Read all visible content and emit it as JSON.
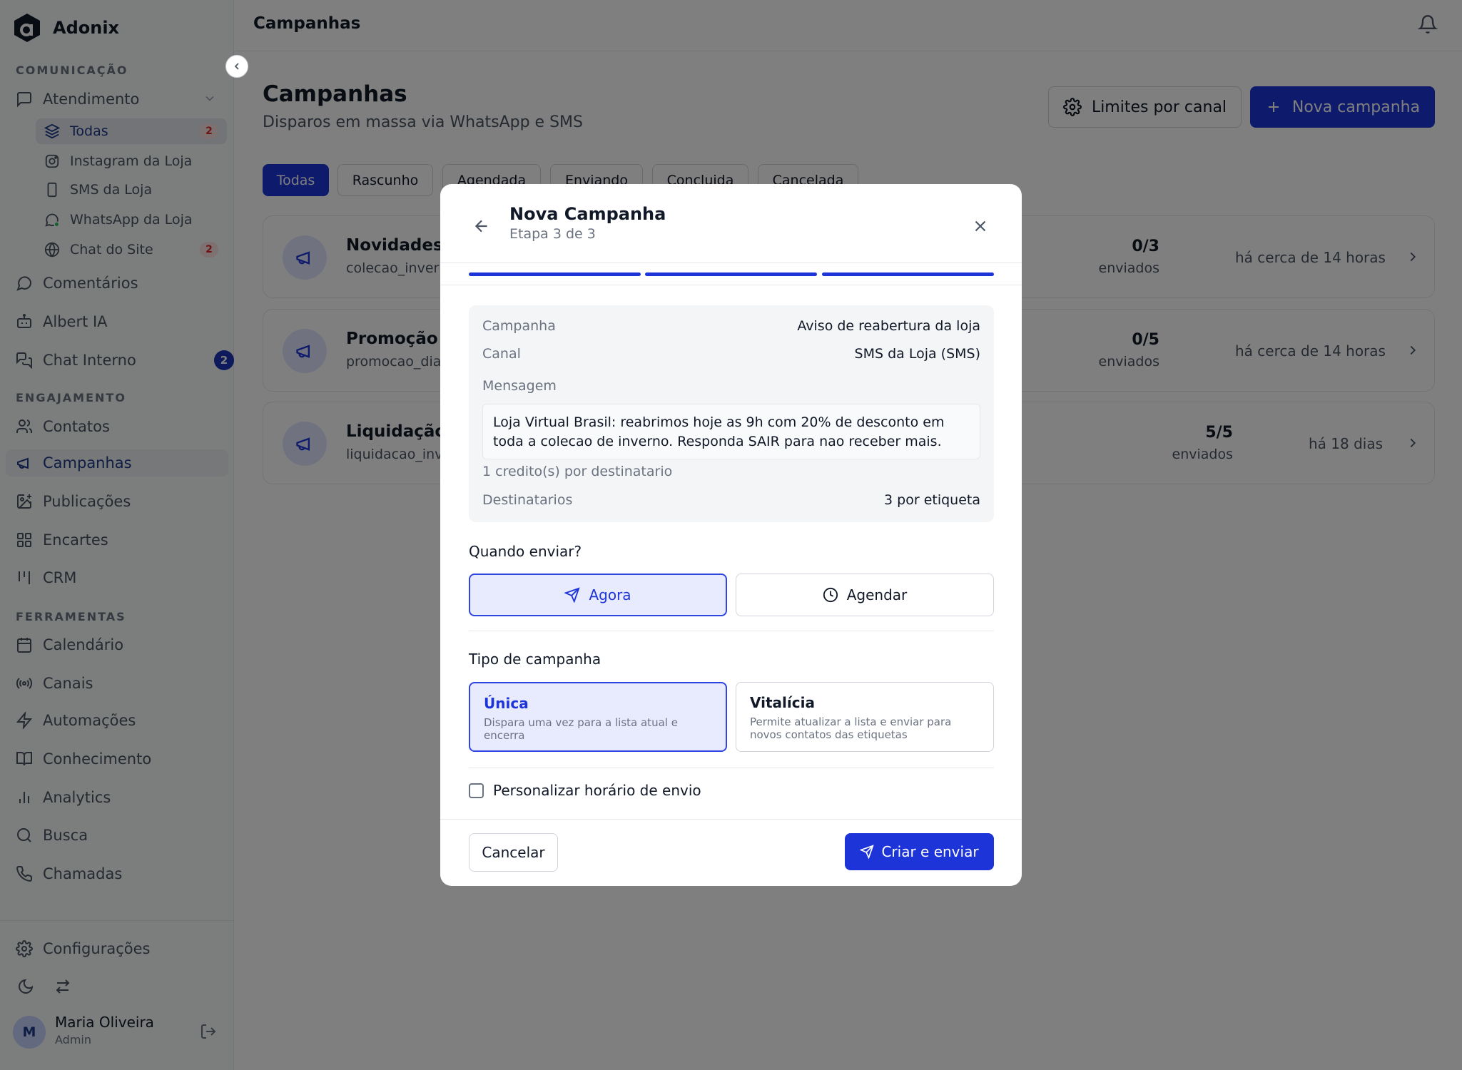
{
  "brand": {
    "name": "Adonix"
  },
  "sidebar": {
    "sections": [
      "COMUNICAÇÃO",
      "ENGAJAMENTO",
      "FERRAMENTAS"
    ],
    "atendimento": "Atendimento",
    "sub_items": [
      {
        "label": "Todas",
        "badge": "2"
      },
      {
        "label": "Instagram da Loja"
      },
      {
        "label": "SMS da Loja"
      },
      {
        "label": "WhatsApp da Loja"
      },
      {
        "label": "Chat do Site",
        "badge": "2"
      }
    ],
    "items": {
      "comentarios": "Comentários",
      "albert": "Albert IA",
      "chat_interno": "Chat Interno",
      "chat_interno_badge": "2",
      "contatos": "Contatos",
      "campanhas": "Campanhas",
      "publicacoes": "Publicações",
      "encartes": "Encartes",
      "crm": "CRM",
      "calendario": "Calendário",
      "canais": "Canais",
      "automacoes": "Automações",
      "conhecimento": "Conhecimento",
      "analytics": "Analytics",
      "busca": "Busca",
      "chamadas": "Chamadas",
      "configuracoes": "Configurações"
    },
    "user": {
      "initial": "M",
      "name": "Maria Oliveira",
      "role": "Admin"
    }
  },
  "topbar": {
    "title": "Campanhas"
  },
  "page": {
    "title": "Campanhas",
    "subtitle": "Disparos em massa via WhatsApp e SMS",
    "limits_button": "Limites por canal",
    "new_button": "Nova campanha",
    "filters": [
      "Todas",
      "Rascunho",
      "Agendada",
      "Enviando",
      "Concluida",
      "Cancelada"
    ],
    "campaigns": [
      {
        "name": "Novidades",
        "slug": "colecao_inver",
        "count": "0/3",
        "sent": "enviados",
        "time": "há cerca de 14 horas"
      },
      {
        "name": "Promoção",
        "slug": "promocao_dia",
        "count": "0/5",
        "sent": "enviados",
        "time": "há cerca de 14 horas"
      },
      {
        "name": "Liquidação",
        "slug": "liquidacao_inv",
        "count": "5/5",
        "sent": "enviados",
        "time": "há 18 dias"
      }
    ]
  },
  "modal": {
    "title": "Nova Campanha",
    "step": "Etapa 3 de 3",
    "progress": {
      "current": 3,
      "total": 3
    },
    "summary": {
      "campaign_label": "Campanha",
      "campaign_value": "Aviso de reabertura da loja",
      "channel_label": "Canal",
      "channel_value": "SMS da Loja (SMS)",
      "message_label": "Mensagem",
      "message_text": "Loja Virtual Brasil: reabrimos hoje as 9h com 20% de desconto em toda a colecao de inverno. Responda SAIR para nao receber mais.",
      "credits": "1 credito(s) por destinatario",
      "recipients_label": "Destinatarios",
      "recipients_value": "3 por etiqueta"
    },
    "when_label": "Quando enviar?",
    "when_options": {
      "now": "Agora",
      "schedule": "Agendar"
    },
    "type_label": "Tipo de campanha",
    "types": [
      {
        "title": "Única",
        "desc": "Dispara uma vez para a lista atual e encerra"
      },
      {
        "title": "Vitalícia",
        "desc": "Permite atualizar a lista e enviar para novos contatos das etiquetas"
      }
    ],
    "custom_time_label": "Personalizar horário de envio",
    "cancel_button": "Cancelar",
    "create_button": "Criar e enviar"
  },
  "colors": {
    "primary": "#1d34d8",
    "selected_bg": "#e8ebfd",
    "badge_red": "#dc2626"
  }
}
